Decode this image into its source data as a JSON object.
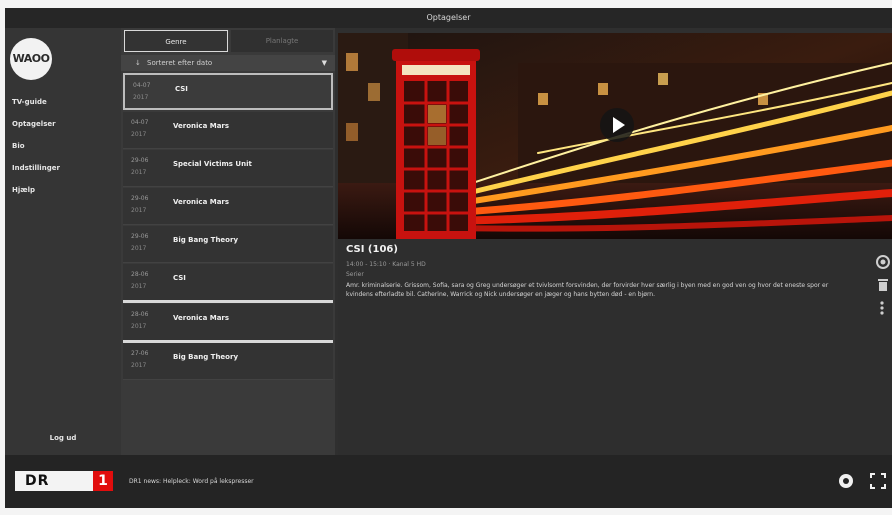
{
  "window": {
    "title": "Optagelser"
  },
  "sidebar": {
    "logo": "WAOO",
    "items": [
      {
        "label": "TV-guide"
      },
      {
        "label": "Optagelser"
      },
      {
        "label": "Bio"
      },
      {
        "label": "Indstillinger"
      },
      {
        "label": "Hjælp"
      }
    ],
    "logout": "Log ud"
  },
  "list": {
    "tabs": [
      {
        "label": "Genre"
      },
      {
        "label": "Planlagte"
      }
    ],
    "sort_label": "Sorteret efter dato",
    "rows": [
      {
        "date": "04-07",
        "year": "2017",
        "title": "CSI"
      },
      {
        "date": "04-07",
        "year": "2017",
        "title": "Veronica Mars"
      },
      {
        "date": "29-06",
        "year": "2017",
        "title": "Special Victims Unit"
      },
      {
        "date": "29-06",
        "year": "2017",
        "title": "Veronica Mars"
      },
      {
        "date": "29-06",
        "year": "2017",
        "title": "Big Bang Theory"
      },
      {
        "date": "28-06",
        "year": "2017",
        "title": "CSI"
      },
      {
        "date": "28-06",
        "year": "2017",
        "title": "Veronica Mars"
      },
      {
        "date": "27-06",
        "year": "2017",
        "title": "Big Bang Theory"
      }
    ]
  },
  "detail": {
    "title": "CSI (106)",
    "meta": "14:00 - 15:10 · Kanal 5 HD",
    "genre": "Serier",
    "description": "Amr. kriminalserie. Grissom, Sofia, sara og Greg undersøger et tvivlsomt forsvinden, der forvirder hver særlig i byen med en god ven og hvor det eneste spor er kvindens efterladte bil. Catherine, Warrick og Nick undersøger en jæger og hans bytten død - en bjørn."
  },
  "bottom": {
    "channel_name": "DR",
    "channel_number": "1",
    "now_playing": "DR1 news: Helpleck: Word på lekspresser"
  }
}
